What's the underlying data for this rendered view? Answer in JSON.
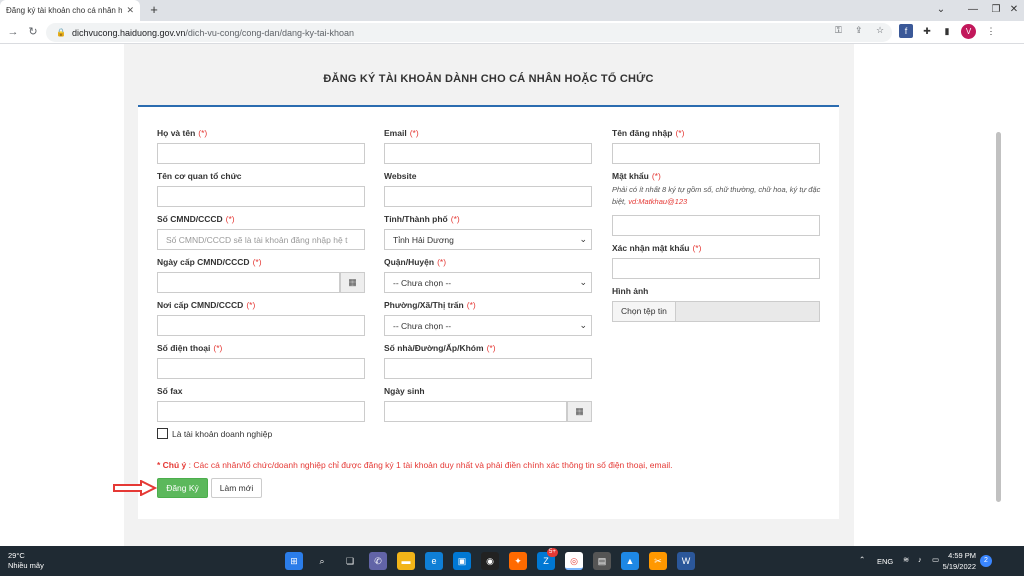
{
  "browser": {
    "tab_title": "Đăng ký tài khoản cho cá nhân h",
    "url_domain": "dichvucong.haiduong.gov.vn",
    "url_path": "/dich-vu-cong/cong-dan/dang-ky-tai-khoan",
    "avatar_letter": "V"
  },
  "form": {
    "title": "ĐĂNG KÝ TÀI KHOẢN DÀNH CHO CÁ NHÂN HOẶC TỔ CHỨC",
    "required_mark": "(*)",
    "col1": {
      "full_name": "Họ và tên",
      "org_name": "Tên cơ quan tổ chức",
      "id_number": "Số CMND/CCCD",
      "id_placeholder": "Số CMND/CCCD sẽ là tài khoản đăng nhập hệ t",
      "issue_date": "Ngày cấp CMND/CCCD",
      "issue_place": "Nơi cấp CMND/CCCD",
      "phone": "Số điện thoại",
      "fax": "Số fax",
      "business_checkbox": "Là tài khoản doanh nghiệp"
    },
    "col2": {
      "email": "Email",
      "website": "Website",
      "province": "Tỉnh/Thành phố",
      "province_value": "Tỉnh Hải Dương",
      "district": "Quận/Huyện",
      "district_value": "-- Chưa chọn --",
      "ward": "Phường/Xã/Thị trấn",
      "ward_value": "-- Chưa chọn --",
      "address": "Số nhà/Đường/Ấp/Khóm",
      "birthday": "Ngày sinh"
    },
    "col3": {
      "username": "Tên đăng nhập",
      "password": "Mật khẩu",
      "password_hint": "Phải có ít nhất 8 ký tự gồm số, chữ thường, chữ hoa, ký tự đặc biệt,",
      "password_example": "vd:Matkhau@123",
      "confirm_password": "Xác nhận mật khẩu",
      "image": "Hình ảnh",
      "choose_file": "Chọn tệp tin"
    },
    "note_label": "* Chú ý",
    "note_text": ": Các cá nhân/tổ chức/doanh nghiệp chỉ được đăng ký 1 tài khoản duy nhất và phải điền chính xác thông tin số điện thoại, email.",
    "register_button": "Đăng Ký",
    "reset_button": "Làm mới"
  },
  "taskbar": {
    "temperature": "29°C",
    "weather": "Nhiều mây",
    "language": "ENG",
    "time": "4:59 PM",
    "date": "5/19/2022",
    "notifications": "2",
    "badge": "5+"
  }
}
